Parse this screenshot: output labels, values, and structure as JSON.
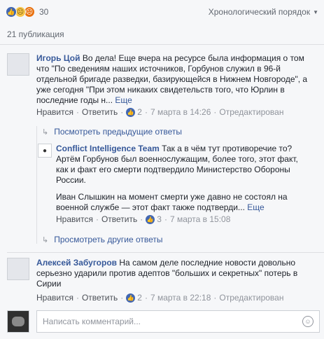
{
  "reactions": {
    "count": "30",
    "icons": [
      "like-icon",
      "sad-icon",
      "angry-icon"
    ]
  },
  "sort": {
    "label": "Хронологический порядок"
  },
  "publications": "21 публикация",
  "comments": [
    {
      "author": "Игорь Цой",
      "text": "Во дела! Еще вчера на ресурсе была информация о том что \"По сведениям наших источников, Горбунов служил в 96-й отдельной бригаде разведки, базирующейся в Нижнем Новгороде\", а уже сегодня \"При этом никаких свидетельств того, что Юрлин в последние годы н...",
      "more": "Еще",
      "like": "Нравится",
      "reply": "Ответить",
      "likes": "2",
      "date": "7 марта в 14:26",
      "edited": "Отредактирован"
    },
    {
      "author": "Conflict Intelligence Team",
      "text1": "Так а в чём тут противоречие то? Артём Горбунов был военнослужащим, более того, этот факт, как и факт его смерти подтвердило Министерство Обороны России.",
      "text2": "Иван Слышкин на момент смерти уже давно не состоял на военной службе — этот факт также подтверди...",
      "more": "Еще",
      "like": "Нравится",
      "reply": "Ответить",
      "likes": "3",
      "date": "7 марта в 15:08"
    },
    {
      "author": "Алексей Забугоров",
      "text": "На самом деле последние новости довольно серьезно ударили против адептов \"больших и секретных\" потерь в Сирии",
      "like": "Нравится",
      "reply": "Ответить",
      "likes": "2",
      "date": "7 марта в 22:18",
      "edited": "Отредактирован"
    }
  ],
  "prev_replies": "Посмотреть предыдущие ответы",
  "other_replies": "Просмотреть другие ответы",
  "write": {
    "placeholder": "Написать комментарий..."
  },
  "colors": {
    "link": "#365899",
    "like": "#4267b2",
    "meta": "#90949c"
  }
}
